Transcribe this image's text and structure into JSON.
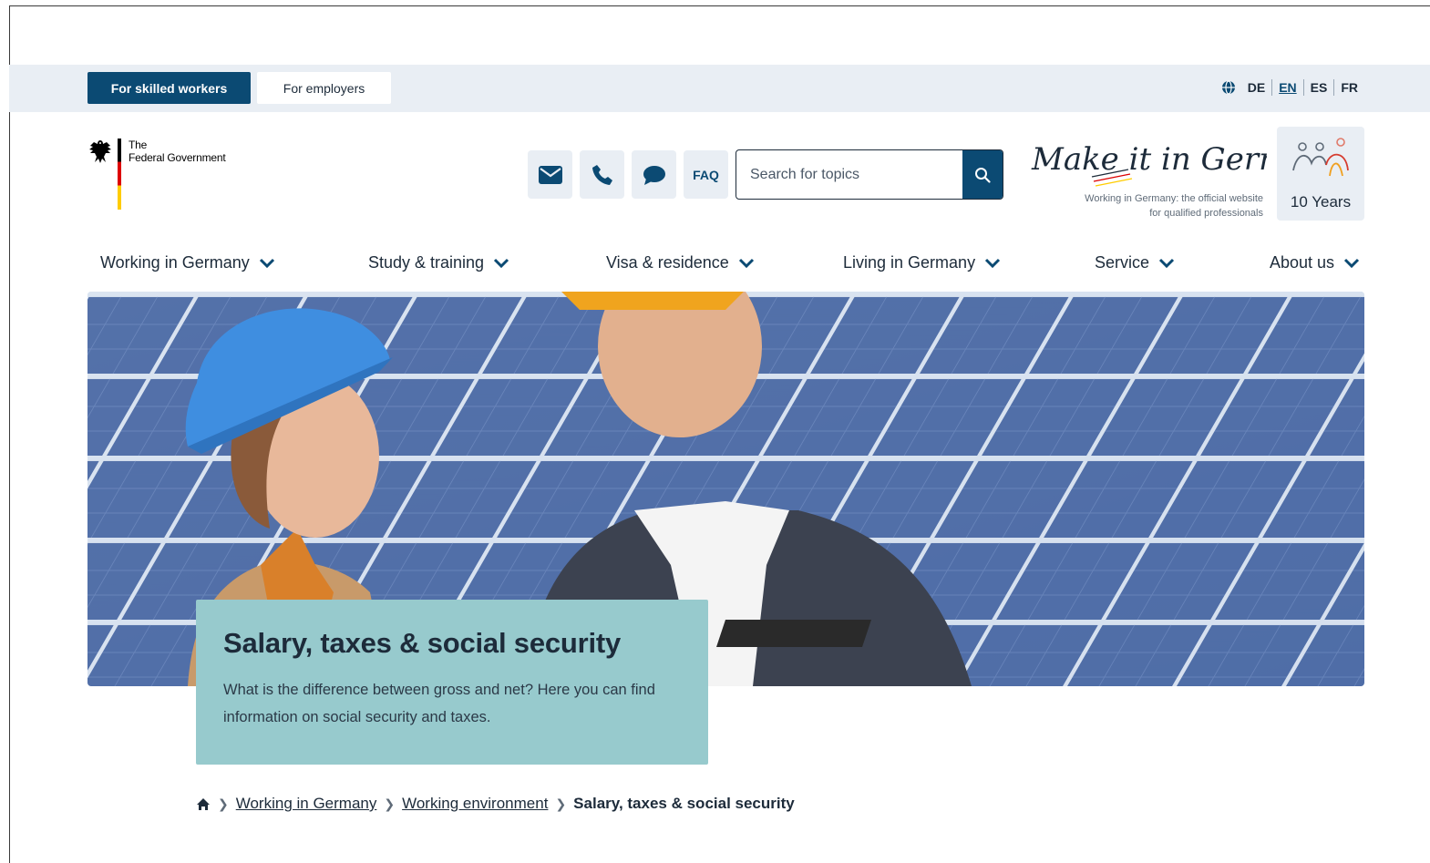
{
  "audience": {
    "skilled_workers": "For skilled workers",
    "employers": "For employers"
  },
  "languages": [
    "DE",
    "EN",
    "ES",
    "FR"
  ],
  "active_language": "EN",
  "logo": {
    "line1": "The",
    "line2": "Federal Government"
  },
  "header": {
    "faq_label": "FAQ",
    "search_placeholder": "Search for topics",
    "brand_script": "Make it in Germany",
    "brand_tagline_1": "Working in Germany: the official website",
    "brand_tagline_2": "for qualified professionals",
    "anniversary_label": "10 Years"
  },
  "nav": [
    "Working in Germany",
    "Study & training",
    "Visa & residence",
    "Living in Germany",
    "Service",
    "About us"
  ],
  "hero": {
    "title": "Salary, taxes & social security",
    "description": "What is the difference between gross and net? Here you can find information on social security and taxes."
  },
  "breadcrumb": {
    "items": [
      "Working in Germany",
      "Working environment"
    ],
    "current": "Salary, taxes & social security"
  },
  "colors": {
    "primary": "#0b4a73",
    "topbar_bg": "#e9eef4",
    "teaser_bg": "#97cacd",
    "text": "#1d2b3a"
  }
}
